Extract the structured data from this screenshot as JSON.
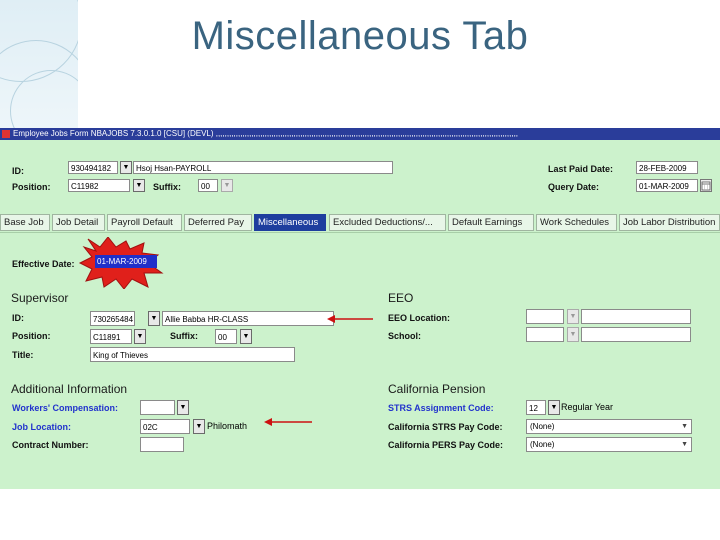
{
  "slide": {
    "title": "Miscellaneous Tab"
  },
  "window": {
    "title": "Employee Jobs Form NBAJOBS 7.3.0.1.0 [CSU] (DEVL) ,,,,,,,,,,,,,,,,,,,,,,,,,,,,,,,,,,,,,,,,,,,,,,,,,,,,,,,,,,,,,,,,,,,,,,,,,,,,,,,,,,,,,,,,,,,,,,,,,,,,,,,,,,,,,,,,,,,,,,,,,,,,,,,,,,,,,,,,"
  },
  "header": {
    "id_label": "ID:",
    "id_value": "930494182",
    "name_value": "Hsoj Hsan-PAYROLL",
    "position_label": "Position:",
    "position_value": "C11982",
    "suffix_label": "Suffix:",
    "suffix_value": "00",
    "last_paid_label": "Last Paid Date:",
    "last_paid_value": "28-FEB-2009",
    "query_date_label": "Query Date:",
    "query_date_value": "01-MAR-2009"
  },
  "tabs": [
    {
      "label": "Base Job"
    },
    {
      "label": "Job Detail"
    },
    {
      "label": "Payroll Default"
    },
    {
      "label": "Deferred Pay"
    },
    {
      "label": "Miscellaneous"
    },
    {
      "label": "Excluded Deductions/..."
    },
    {
      "label": "Default Earnings"
    },
    {
      "label": "Work Schedules"
    },
    {
      "label": "Job Labor Distribution"
    }
  ],
  "active_tab": "Miscellaneous",
  "effective": {
    "label": "Effective Date:",
    "value": "01-MAR-2009"
  },
  "supervisor": {
    "heading": "Supervisor",
    "id_label": "ID:",
    "id_value": "730265484",
    "name_value": "Allie Babba HR-CLASS",
    "position_label": "Position:",
    "position_value": "C11891",
    "suffix_label": "Suffix:",
    "suffix_value": "00",
    "title_label": "Title:",
    "title_value": "King of Thieves"
  },
  "eeo": {
    "heading": "EEO",
    "location_label": "EEO Location:",
    "school_label": "School:"
  },
  "additional": {
    "heading": "Additional Information",
    "workers_comp_label": "Workers' Compensation:",
    "job_location_label": "Job Location:",
    "job_location_value": "02C",
    "job_location_desc": "Philomath",
    "contract_label": "Contract Number:"
  },
  "pension": {
    "heading": "California Pension",
    "strs_assignment_label": "STRS Assignment Code:",
    "strs_assignment_value": "12",
    "strs_assignment_desc": "Regular Year",
    "strs_pay_label": "California STRS Pay Code:",
    "strs_pay_value": "(None)",
    "pers_pay_label": "California PERS Pay Code:",
    "pers_pay_value": "(None)"
  },
  "colors": {
    "form_bg": "#ccf2cc",
    "titlebar": "#2a3d9a",
    "active_tab": "#1e3e9e",
    "highlight_burst": "#e0201b",
    "arrow": "#cc1111",
    "blue_label": "#2233cc"
  },
  "icons": {
    "dropdown": "triangle-down",
    "calendar": "calendar-icon"
  }
}
